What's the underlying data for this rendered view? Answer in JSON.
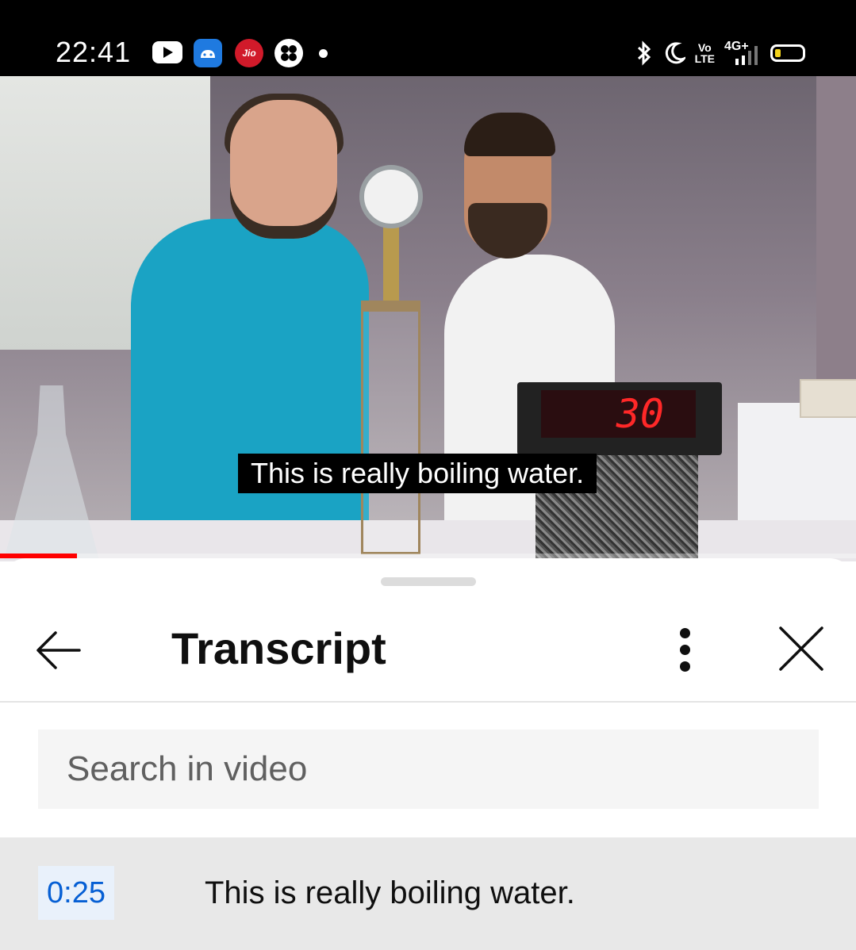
{
  "status_bar": {
    "time": "22:41",
    "left_icons": [
      "youtube-icon",
      "android-icon",
      "jio-icon",
      "game-icon",
      "dot-icon"
    ],
    "jio_label": "Jio",
    "right_icons": [
      "bluetooth-icon",
      "moon-icon",
      "volte-icon",
      "signal-icon",
      "battery-icon"
    ],
    "volte_top": "Vo",
    "volte_bottom": "LTE",
    "network": "4G+",
    "battery_color": "#f2d21b"
  },
  "video": {
    "caption": "This is really boiling water.",
    "timer_display": "30",
    "progress": 0.09,
    "progress_color": "#ff0000"
  },
  "transcript": {
    "title": "Transcript",
    "search_placeholder": "Search in video",
    "segments": [
      {
        "timestamp": "0:25",
        "text": "This is really boiling water."
      }
    ],
    "timestamp_color": "#065fd4"
  }
}
